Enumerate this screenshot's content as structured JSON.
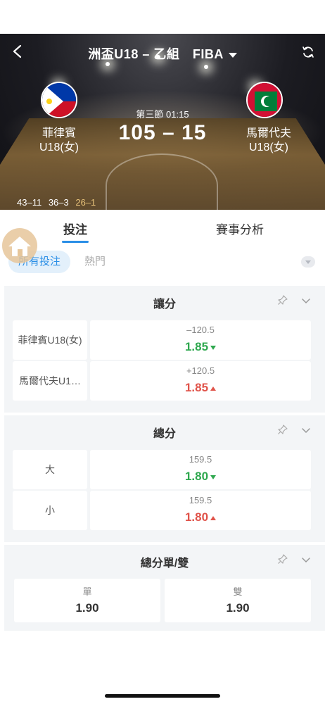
{
  "header": {
    "title": "洲盃U18 – 乙組　FIBA",
    "period": "第三節",
    "clock": "01:15",
    "score": "105 – 15",
    "home_team": {
      "line1": "菲律賓",
      "line2": "U18(女)"
    },
    "away_team": {
      "line1": "馬爾代夫",
      "line2": "U18(女)"
    },
    "quarters": [
      "43–11",
      "36–3",
      "26–1"
    ]
  },
  "tabs": {
    "bet": "投注",
    "analysis": "賽事分析"
  },
  "filter": {
    "all": "所有投注",
    "hot": "熱門"
  },
  "markets": {
    "handicap": {
      "title": "讓分",
      "rows": [
        {
          "label": "菲律賓U18(女)",
          "line": "–120.5",
          "odds": "1.85",
          "trend": "down"
        },
        {
          "label": "馬爾代夫U1…",
          "line": "+120.5",
          "odds": "1.85",
          "trend": "up"
        }
      ]
    },
    "total": {
      "title": "總分",
      "rows": [
        {
          "label": "大",
          "line": "159.5",
          "odds": "1.80",
          "trend": "down"
        },
        {
          "label": "小",
          "line": "159.5",
          "odds": "1.80",
          "trend": "up"
        }
      ]
    },
    "odd_even": {
      "title": "總分單/雙",
      "odd": {
        "label": "單",
        "odds": "1.90"
      },
      "even": {
        "label": "雙",
        "odds": "1.90"
      }
    }
  },
  "colors": {
    "accent": "#2a8ee6",
    "odds_down": "#2fa84f",
    "odds_up": "#e0534a",
    "section_bg": "#f3f5f7"
  },
  "icons": [
    "back-icon",
    "refresh-icon",
    "philippines-flag-icon",
    "maldives-flag-icon",
    "home-icon",
    "pin-icon",
    "chevron-down-icon"
  ]
}
